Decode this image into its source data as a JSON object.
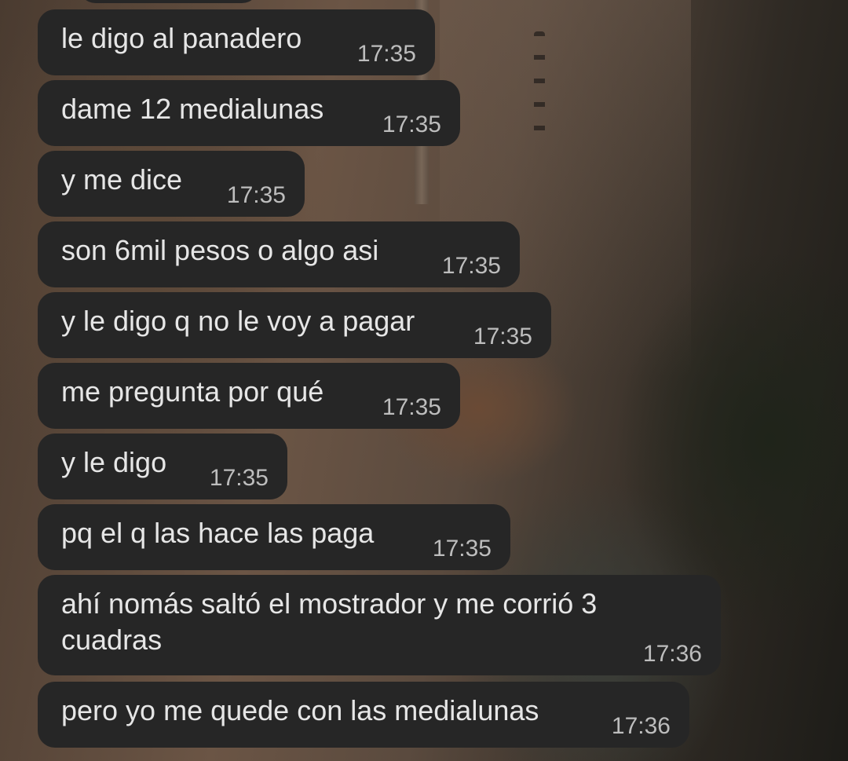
{
  "messages": [
    {
      "text": "le digo al panadero",
      "time": "17:35"
    },
    {
      "text": "dame 12 medialunas",
      "time": "17:35"
    },
    {
      "text": "y me dice",
      "time": "17:35"
    },
    {
      "text": "son 6mil pesos o algo asi",
      "time": "17:35"
    },
    {
      "text": "y le digo q no le voy a pagar",
      "time": "17:35"
    },
    {
      "text": "me pregunta por qué",
      "time": "17:35"
    },
    {
      "text": "y le digo",
      "time": "17:35"
    },
    {
      "text": "pq el q las hace las paga",
      "time": "17:35"
    },
    {
      "text": "ahí nomás saltó el mostrador y me corrió 3 cuadras",
      "time": "17:36"
    },
    {
      "text": "pero yo me quede con las medialunas",
      "time": "17:36"
    }
  ],
  "colors": {
    "bubble": "#262626",
    "text": "#e6e6e6",
    "time": "#bdbdbd"
  }
}
